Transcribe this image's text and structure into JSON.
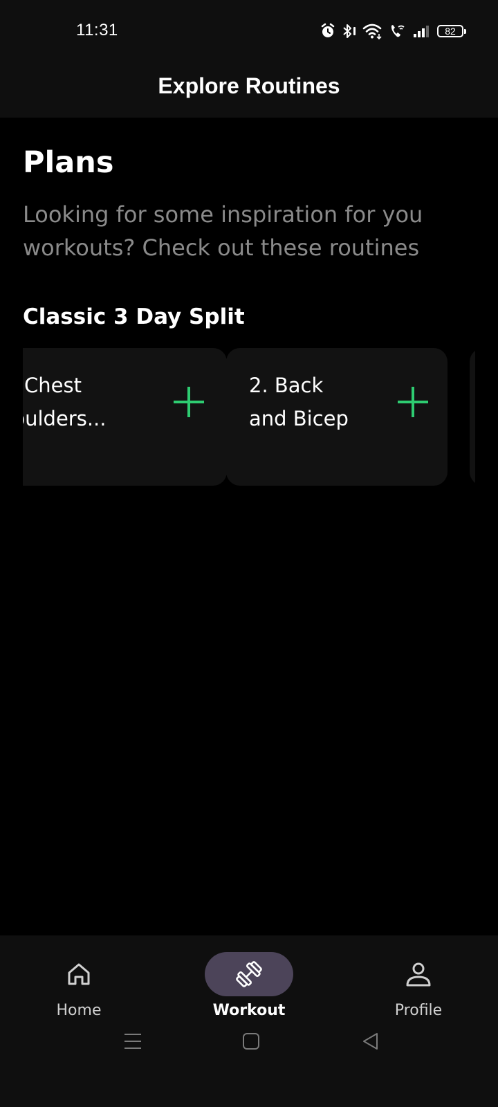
{
  "status_bar": {
    "time": "11:31",
    "battery": "82",
    "icons": [
      "alarm-icon",
      "bluetooth-icon",
      "wifi-icon",
      "wifi-calling-icon",
      "signal-icon",
      "battery-icon"
    ]
  },
  "app_bar": {
    "title": "Explore Routines"
  },
  "main": {
    "heading": "Plans",
    "description": "Looking for some inspiration for you workouts? Check out these routines",
    "section_title": "Classic 3 Day Split",
    "cards": [
      {
        "line1": "Chest",
        "line2": "houlders...",
        "action_icon": "plus-icon"
      },
      {
        "line1": "2. Back",
        "line2": "and Bicep",
        "action_icon": "plus-icon"
      }
    ]
  },
  "bottom_nav": {
    "items": [
      {
        "label": "Home",
        "icon": "home-icon",
        "active": false
      },
      {
        "label": "Workout",
        "icon": "dumbbell-icon",
        "active": true
      },
      {
        "label": "Profile",
        "icon": "person-icon",
        "active": false
      }
    ]
  },
  "system_nav": {
    "icons": [
      "menu-icon",
      "home-square-icon",
      "back-triangle-icon"
    ]
  },
  "colors": {
    "background": "#000000",
    "surface": "#0f0f0f",
    "card": "#121212",
    "accent_green": "#2ecc71",
    "active_pill": "#4c4459",
    "muted_text": "#8a8a8a"
  }
}
